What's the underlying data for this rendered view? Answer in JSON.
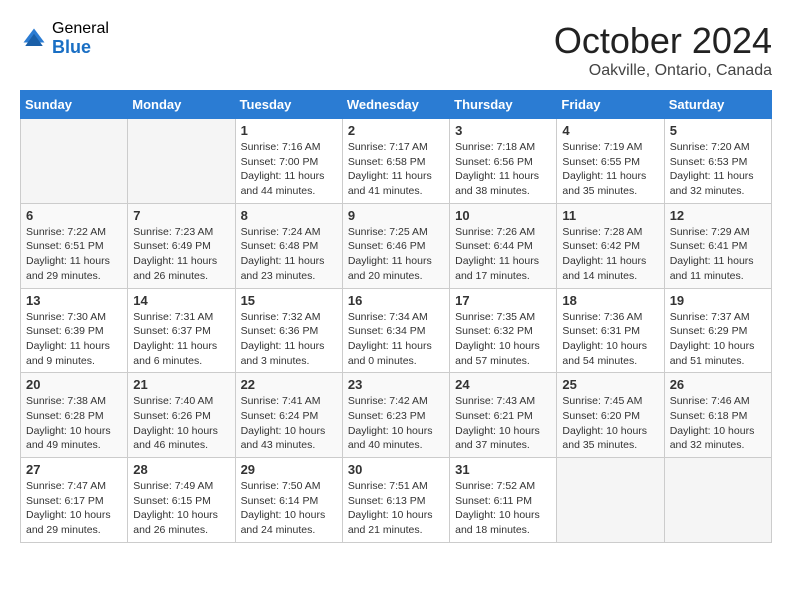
{
  "header": {
    "logo_general": "General",
    "logo_blue": "Blue",
    "month": "October 2024",
    "location": "Oakville, Ontario, Canada"
  },
  "days_of_week": [
    "Sunday",
    "Monday",
    "Tuesday",
    "Wednesday",
    "Thursday",
    "Friday",
    "Saturday"
  ],
  "weeks": [
    [
      {
        "day": "",
        "empty": true
      },
      {
        "day": "",
        "empty": true
      },
      {
        "day": "1",
        "sunrise": "Sunrise: 7:16 AM",
        "sunset": "Sunset: 7:00 PM",
        "daylight": "Daylight: 11 hours and 44 minutes."
      },
      {
        "day": "2",
        "sunrise": "Sunrise: 7:17 AM",
        "sunset": "Sunset: 6:58 PM",
        "daylight": "Daylight: 11 hours and 41 minutes."
      },
      {
        "day": "3",
        "sunrise": "Sunrise: 7:18 AM",
        "sunset": "Sunset: 6:56 PM",
        "daylight": "Daylight: 11 hours and 38 minutes."
      },
      {
        "day": "4",
        "sunrise": "Sunrise: 7:19 AM",
        "sunset": "Sunset: 6:55 PM",
        "daylight": "Daylight: 11 hours and 35 minutes."
      },
      {
        "day": "5",
        "sunrise": "Sunrise: 7:20 AM",
        "sunset": "Sunset: 6:53 PM",
        "daylight": "Daylight: 11 hours and 32 minutes."
      }
    ],
    [
      {
        "day": "6",
        "sunrise": "Sunrise: 7:22 AM",
        "sunset": "Sunset: 6:51 PM",
        "daylight": "Daylight: 11 hours and 29 minutes."
      },
      {
        "day": "7",
        "sunrise": "Sunrise: 7:23 AM",
        "sunset": "Sunset: 6:49 PM",
        "daylight": "Daylight: 11 hours and 26 minutes."
      },
      {
        "day": "8",
        "sunrise": "Sunrise: 7:24 AM",
        "sunset": "Sunset: 6:48 PM",
        "daylight": "Daylight: 11 hours and 23 minutes."
      },
      {
        "day": "9",
        "sunrise": "Sunrise: 7:25 AM",
        "sunset": "Sunset: 6:46 PM",
        "daylight": "Daylight: 11 hours and 20 minutes."
      },
      {
        "day": "10",
        "sunrise": "Sunrise: 7:26 AM",
        "sunset": "Sunset: 6:44 PM",
        "daylight": "Daylight: 11 hours and 17 minutes."
      },
      {
        "day": "11",
        "sunrise": "Sunrise: 7:28 AM",
        "sunset": "Sunset: 6:42 PM",
        "daylight": "Daylight: 11 hours and 14 minutes."
      },
      {
        "day": "12",
        "sunrise": "Sunrise: 7:29 AM",
        "sunset": "Sunset: 6:41 PM",
        "daylight": "Daylight: 11 hours and 11 minutes."
      }
    ],
    [
      {
        "day": "13",
        "sunrise": "Sunrise: 7:30 AM",
        "sunset": "Sunset: 6:39 PM",
        "daylight": "Daylight: 11 hours and 9 minutes."
      },
      {
        "day": "14",
        "sunrise": "Sunrise: 7:31 AM",
        "sunset": "Sunset: 6:37 PM",
        "daylight": "Daylight: 11 hours and 6 minutes."
      },
      {
        "day": "15",
        "sunrise": "Sunrise: 7:32 AM",
        "sunset": "Sunset: 6:36 PM",
        "daylight": "Daylight: 11 hours and 3 minutes."
      },
      {
        "day": "16",
        "sunrise": "Sunrise: 7:34 AM",
        "sunset": "Sunset: 6:34 PM",
        "daylight": "Daylight: 11 hours and 0 minutes."
      },
      {
        "day": "17",
        "sunrise": "Sunrise: 7:35 AM",
        "sunset": "Sunset: 6:32 PM",
        "daylight": "Daylight: 10 hours and 57 minutes."
      },
      {
        "day": "18",
        "sunrise": "Sunrise: 7:36 AM",
        "sunset": "Sunset: 6:31 PM",
        "daylight": "Daylight: 10 hours and 54 minutes."
      },
      {
        "day": "19",
        "sunrise": "Sunrise: 7:37 AM",
        "sunset": "Sunset: 6:29 PM",
        "daylight": "Daylight: 10 hours and 51 minutes."
      }
    ],
    [
      {
        "day": "20",
        "sunrise": "Sunrise: 7:38 AM",
        "sunset": "Sunset: 6:28 PM",
        "daylight": "Daylight: 10 hours and 49 minutes."
      },
      {
        "day": "21",
        "sunrise": "Sunrise: 7:40 AM",
        "sunset": "Sunset: 6:26 PM",
        "daylight": "Daylight: 10 hours and 46 minutes."
      },
      {
        "day": "22",
        "sunrise": "Sunrise: 7:41 AM",
        "sunset": "Sunset: 6:24 PM",
        "daylight": "Daylight: 10 hours and 43 minutes."
      },
      {
        "day": "23",
        "sunrise": "Sunrise: 7:42 AM",
        "sunset": "Sunset: 6:23 PM",
        "daylight": "Daylight: 10 hours and 40 minutes."
      },
      {
        "day": "24",
        "sunrise": "Sunrise: 7:43 AM",
        "sunset": "Sunset: 6:21 PM",
        "daylight": "Daylight: 10 hours and 37 minutes."
      },
      {
        "day": "25",
        "sunrise": "Sunrise: 7:45 AM",
        "sunset": "Sunset: 6:20 PM",
        "daylight": "Daylight: 10 hours and 35 minutes."
      },
      {
        "day": "26",
        "sunrise": "Sunrise: 7:46 AM",
        "sunset": "Sunset: 6:18 PM",
        "daylight": "Daylight: 10 hours and 32 minutes."
      }
    ],
    [
      {
        "day": "27",
        "sunrise": "Sunrise: 7:47 AM",
        "sunset": "Sunset: 6:17 PM",
        "daylight": "Daylight: 10 hours and 29 minutes."
      },
      {
        "day": "28",
        "sunrise": "Sunrise: 7:49 AM",
        "sunset": "Sunset: 6:15 PM",
        "daylight": "Daylight: 10 hours and 26 minutes."
      },
      {
        "day": "29",
        "sunrise": "Sunrise: 7:50 AM",
        "sunset": "Sunset: 6:14 PM",
        "daylight": "Daylight: 10 hours and 24 minutes."
      },
      {
        "day": "30",
        "sunrise": "Sunrise: 7:51 AM",
        "sunset": "Sunset: 6:13 PM",
        "daylight": "Daylight: 10 hours and 21 minutes."
      },
      {
        "day": "31",
        "sunrise": "Sunrise: 7:52 AM",
        "sunset": "Sunset: 6:11 PM",
        "daylight": "Daylight: 10 hours and 18 minutes."
      },
      {
        "day": "",
        "empty": true
      },
      {
        "day": "",
        "empty": true
      }
    ]
  ]
}
